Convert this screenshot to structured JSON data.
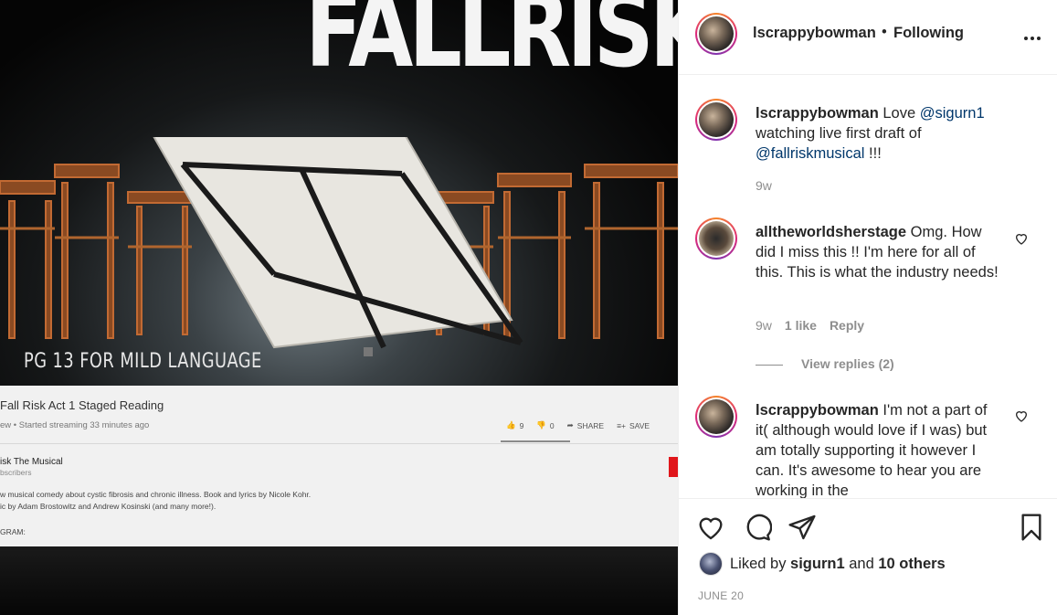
{
  "post": {
    "username": "lscrappybowman",
    "separator": "•",
    "follow_status": "Following",
    "more_label": "•••",
    "caption": {
      "username": "lscrappybowman",
      "text_before": " Love ",
      "mention1": "@sigurn1",
      "text_middle": " watching live first draft of ",
      "mention2": "@fallriskmusical",
      "text_after": " !!!",
      "time": "9w"
    },
    "comments": [
      {
        "username": "alltheworldsherstage",
        "text": " Omg. How did I miss this !! I'm here for all of this. This is what the industry needs!",
        "time": "9w",
        "likes": "1 like",
        "reply": "Reply",
        "view_replies": "View replies (2)"
      },
      {
        "username": "lscrappybowman",
        "text": " I'm not a part of it( although would love if I was) but am totally supporting it however I can. It's awesome to hear you are working in the"
      }
    ],
    "liked_by": {
      "prefix": "Liked by ",
      "user": "sigurn1",
      "middle": " and ",
      "others": "10 others"
    },
    "date": "JUNE 20"
  },
  "photo": {
    "poster_title": "FALLRISK",
    "rating": "PG 13 FOR MILD LANGUAGE",
    "video_title": "Fall Risk Act 1 Staged Reading",
    "video_sub": "ew • Started streaming 33 minutes ago",
    "likes": "9",
    "dislikes": "0",
    "share": "SHARE",
    "save": "SAVE",
    "channel": "isk The Musical",
    "subscribers": "bscribers",
    "desc1": "w musical comedy about cystic fibrosis and chronic illness. Book and lyrics by Nicole Kohr.",
    "desc2": "ic by Adam Brostowitz and Andrew Kosinski (and many more!).",
    "instagram_label": "GRAM:"
  },
  "colors": {
    "text": "#262626",
    "muted": "#8e8e8e",
    "mention": "#00376b",
    "border": "#efefef"
  }
}
